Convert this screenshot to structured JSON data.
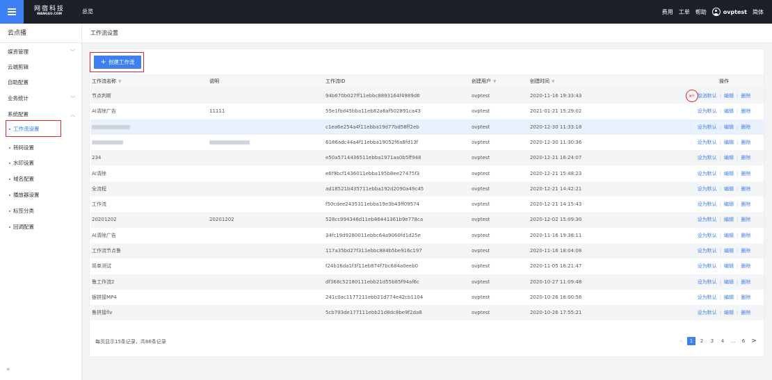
{
  "topbar": {
    "logo_cn": "网宿科技",
    "logo_en": "WANGSU.COM",
    "nav_overview": "总览",
    "links": [
      "费用",
      "工单",
      "帮助"
    ],
    "username": "ovptest",
    "language": "简体"
  },
  "sidebar": {
    "title": "云点播",
    "items": [
      {
        "label": "媒资管理",
        "chevron": "﹀"
      },
      {
        "label": "云端剪辑",
        "chevron": ""
      },
      {
        "label": "自助配置",
        "chevron": ""
      },
      {
        "label": "业务统计",
        "chevron": "﹀"
      },
      {
        "label": "系统配置",
        "chevron": "︿"
      }
    ],
    "sub_items": [
      "工作流设置",
      "转码设置",
      "水印设置",
      "域名配置",
      "播放器设置",
      "标签分类",
      "回调配置"
    ],
    "collapse_icon": "«"
  },
  "breadcrumb": "工作流设置",
  "toolbar": {
    "create_label": "创建工作流",
    "plus": "+"
  },
  "table": {
    "headers": {
      "name": "工作流名称",
      "desc": "说明",
      "id": "工作流ID",
      "user": "创建用户",
      "time": "创建时间",
      "ops": "操作"
    },
    "op_labels": {
      "set_default": "设为默认",
      "cancel_default": "取消默认",
      "edit": "编辑",
      "delete": "删除"
    },
    "stamp_text": "默认",
    "rows": [
      {
        "name": "节点判断",
        "desc": "",
        "id": "94b670b027ff11ebbc8893164f4989d6",
        "user": "ovptest",
        "time": "2020-11-16 19:33:43",
        "is_default": true
      },
      {
        "name": "AI清除广告",
        "desc": "11111",
        "id": "55e1fbd45bba11eb82a6af502891ca43",
        "user": "ovptest",
        "time": "2021-01-21 15:29:02",
        "is_default": false
      },
      {
        "name": "",
        "desc": "",
        "id": "c1ea6e254a4f11ebba19d77bd58ff2eb",
        "user": "ovptest",
        "time": "2020-12-30 11:33:18",
        "is_default": false
      },
      {
        "name": "",
        "desc": "",
        "id": "6186adc44a4f11ebba19052f6a8fd13f",
        "user": "ovptest",
        "time": "2020-12-30 11:30:36",
        "is_default": false
      },
      {
        "name": "234",
        "desc": "",
        "id": "e50a5714436511ebba1971aa0b5ff948",
        "user": "ovptest",
        "time": "2020-12-21 16:24:07",
        "is_default": false
      },
      {
        "name": "AI清除",
        "desc": "",
        "id": "e6f9bcf1436011ebba195b8ee27475f3",
        "user": "ovptest",
        "time": "2020-12-21 15:48:23",
        "is_default": false
      },
      {
        "name": "全流程",
        "desc": "",
        "id": "ad18521b435711ebba192d2090a49c45",
        "user": "ovptest",
        "time": "2020-12-21 14:42:21",
        "is_default": false
      },
      {
        "name": "工作流",
        "desc": "",
        "id": "f50cdee2435311ebba19e3b43ff09574",
        "user": "ovptest",
        "time": "2020-12-21 14:15:43",
        "is_default": false
      },
      {
        "name": "20201202",
        "desc": "20201202",
        "id": "528cc994346d11eb86441361b9e778ca",
        "user": "ovptest",
        "time": "2020-12-02 15:09:30",
        "is_default": false
      },
      {
        "name": "AI清除广告",
        "desc": "",
        "id": "34fc19d9280011ebbc64a9060fd1d25e",
        "user": "ovptest",
        "time": "2020-11-16 19:38:11",
        "is_default": false
      },
      {
        "name": "工作流节点鲁",
        "desc": "",
        "id": "117a35bd27f311ebbc884b5be916c197",
        "user": "ovptest",
        "time": "2020-11-16 18:04:08",
        "is_default": false
      },
      {
        "name": "简单测试",
        "desc": "",
        "id": "f24b16da1f3f11eb874f7bc684a0eeb0",
        "user": "ovptest",
        "time": "2020-11-05 16:21:47",
        "is_default": false
      },
      {
        "name": "鲁工作流2",
        "desc": "",
        "id": "df368c52180111ebb21d55b85f94af6c",
        "user": "ovptest",
        "time": "2020-10-27 11:09:48",
        "is_default": false
      },
      {
        "name": "银拼接MP4",
        "desc": "",
        "id": "241c0ac1177211ebb21d774e42cb1104",
        "user": "ovptest",
        "time": "2020-10-26 18:00:56",
        "is_default": false
      },
      {
        "name": "鲁拼接flv",
        "desc": "",
        "id": "5cb793de177111ebb21d8dc8be9f2da8",
        "user": "ovptest",
        "time": "2020-10-26 17:55:21",
        "is_default": false
      }
    ]
  },
  "footer": {
    "summary": "每页显示15条记录，共86条记录",
    "pages": [
      "1",
      "2",
      "3",
      "4",
      "...",
      "6"
    ],
    "prev": "<",
    "next": ">"
  }
}
